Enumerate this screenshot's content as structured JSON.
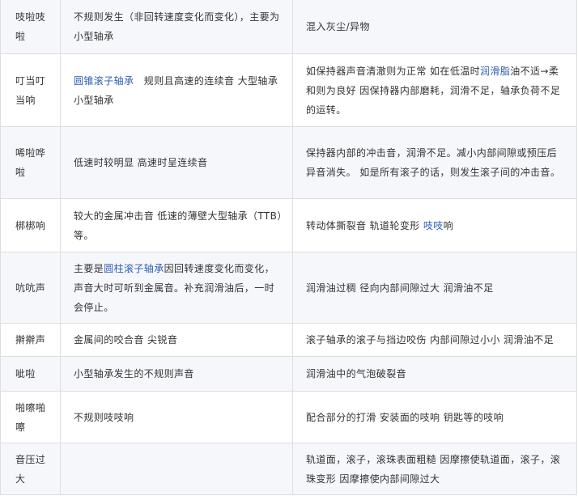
{
  "rows": [
    {
      "symptom": "吱啦吱啦",
      "feature": "不规则发生（非回转速度变化而变化），主要为小型轴承",
      "cause": "混入灰尘/异物"
    },
    {
      "symptom": "叮当叮当响",
      "feature_link": "圆锥滚子轴承",
      "feature_after_link": "　规则且高速的连续音 大型轴承 小型轴承",
      "cause_before_link": "如保持器声音清澈则为正常 如在低温时",
      "cause_link": "润滑脂",
      "cause_after_link": "油不适→柔和则为良好 因保持器内部磨耗，润滑不足，轴承负荷不足的运转。"
    },
    {
      "symptom": "唏啦哗啦",
      "feature": "低速时较明显 高速时呈连续音",
      "cause": "保持器内部的冲击音，润滑不足。减小内部间隙或预压后异音消失。 如是所有滚子的话，则发生滚子间的冲击音。"
    },
    {
      "symptom": "梆梆响",
      "feature": "较大的金属冲击音 低速的薄壁大型轴承（TTB）等。",
      "cause_before_link": "转动体撕裂音 轨道轮变形 ",
      "cause_link": "吱吱",
      "cause_after_link": "响"
    },
    {
      "symptom": "吭吭声",
      "feature_before_link": "主要是",
      "feature_link": "圆柱滚子轴承",
      "feature_after_link": "因回转速度变化而变化，声音大时可听到金属音。补充润滑油后，一时会停止。",
      "cause": "润滑油过稠 径向内部间隙过大 润滑油不足"
    },
    {
      "symptom": "擀擀声",
      "feature": "金属间的咬合音 尖锐音",
      "cause": "滚子轴承的滚子与挡边咬伤 内部间隙过小小 润滑油不足"
    },
    {
      "symptom": "呲啦",
      "feature": "小型轴承发生的不规则声音",
      "cause": "润滑油中的气泡破裂音"
    },
    {
      "symptom": "啪嚓啪嚓",
      "feature": "不规则吱吱响",
      "cause": "配合部分的打滑 安装面的吱响 钥匙等的吱响"
    },
    {
      "symptom": "音压过大",
      "feature": "",
      "cause": "轨道面，滚子，滚珠表面粗糙 因摩擦使轨道面，滚子，滚珠变形 因摩擦使内部间隙过大"
    }
  ],
  "colors": {
    "row_alt": "#f5f7fa",
    "row_plain": "#ffffff",
    "border": "#dedede",
    "text": "#333333",
    "link": "#2a5cb2"
  }
}
